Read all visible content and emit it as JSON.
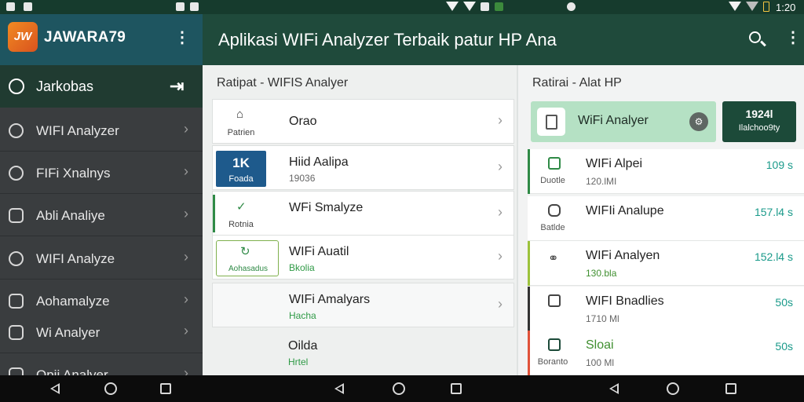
{
  "status": {
    "time": "1:20"
  },
  "sidebar": {
    "brand": "JAWARA79",
    "logo_text": "JW",
    "active": {
      "label": "Jarkobas"
    },
    "items": [
      {
        "label": "WIFI Analyzer",
        "icon": "gauge-icon"
      },
      {
        "label": "FIFi Xnalnys",
        "icon": "router-icon"
      },
      {
        "label": "Abli Analiye",
        "icon": "clipboard-icon"
      },
      {
        "label": "WIFI Analyze",
        "icon": "compass-icon"
      },
      {
        "label": "Aohamalyze",
        "icon": "square-icon"
      },
      {
        "label": "Wi Analyer",
        "icon": "camera-icon"
      },
      {
        "label": "Opii Analyer",
        "icon": "chart-icon"
      }
    ]
  },
  "appbar": {
    "title": "Aplikasi WIFi Analyzer Terbaik patur HP Ana"
  },
  "left_panel": {
    "title": "Ratipat - WIFIS Analyer",
    "items": [
      {
        "name": "Orao",
        "sub": "",
        "caption": "Patrien",
        "thumb_style": "plain"
      },
      {
        "name": "Hiid Aalipa",
        "sub": "19036",
        "caption": "Foada",
        "thumb_value": "1K",
        "thumb_style": "blue"
      },
      {
        "name": "WFi Smalyze",
        "sub": "",
        "caption": "Rotnia",
        "thumb_style": "accent"
      },
      {
        "name": "WIFi Auatil",
        "sub": "Bkolia",
        "caption": "Aohasadus",
        "thumb_style": "outline"
      },
      {
        "name": "WIFi Amalyars",
        "sub": "Hacha",
        "caption": "",
        "thumb_style": "none"
      },
      {
        "name": "Oilda",
        "sub": "Hrtel",
        "caption": "",
        "thumb_style": "none"
      }
    ]
  },
  "right_panel": {
    "title": "Ratirai - Alat HP",
    "featured": {
      "name": "WiFi Analyer"
    },
    "stat": {
      "value": "1924l",
      "label": "Ilalchoo9ty"
    },
    "items": [
      {
        "name": "WIFi Alpei",
        "sub": "120.lMI",
        "caption": "Duotle",
        "value": "109 s",
        "accent": "#2f8a46"
      },
      {
        "name": "WIFIi Analupe",
        "sub": "",
        "caption": "Batlde",
        "value": "157.l4 s",
        "accent": ""
      },
      {
        "name": "WIFi Analyen",
        "sub": "130.bla",
        "caption": "",
        "value": "152.l4 s",
        "accent": "#9cc23c"
      },
      {
        "name": "WIFI Bnadlies",
        "sub": "1710 Ml",
        "caption": "",
        "value": "50s",
        "accent": "#333333"
      },
      {
        "name": "Sloai",
        "sub": "100 Ml",
        "caption": "Boranto",
        "value": "50s",
        "accent": "#e0523a"
      }
    ]
  }
}
